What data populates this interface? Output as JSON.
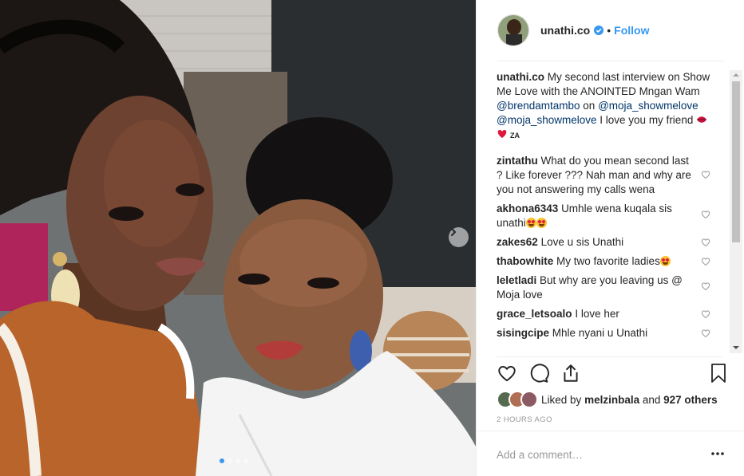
{
  "post": {
    "username": "unathi.co",
    "separator": "•",
    "follow_label": "Follow",
    "caption_parts": {
      "text1": "My second last interview on Show Me Love with the ANOINTED Mngan Wam",
      "mention1": "@brendamtambo",
      "text2": "on",
      "mention2": "@moja_showmelove",
      "mention3": "@moja_showmelove",
      "text3": "I love you my friend",
      "za": "ZA"
    }
  },
  "comments": [
    {
      "username": "zintathu",
      "text": "What do you mean second last ? Like forever ??? Nah man and why are you not answering my calls wena"
    },
    {
      "username": "akhona6343",
      "text": "Umhle wena kuqala sis unathi"
    },
    {
      "username": "zakes62",
      "text": "Love u sis Unathi"
    },
    {
      "username": "thabowhite",
      "text": "My two favorite ladies"
    },
    {
      "username": "leletladi",
      "text": "But why are you leaving us @ Moja love"
    },
    {
      "username": "grace_letsoalo",
      "text": "I love her"
    },
    {
      "username": "sisingcipe",
      "text": "Mhle nyani u Unathi"
    }
  ],
  "likes": {
    "prefix": "Liked by",
    "user": "melzinbala",
    "middle": "and",
    "count": "927 others"
  },
  "timestamp": "2 HOURS AGO",
  "add_comment_placeholder": "Add a comment…",
  "icons": {
    "like": "heart-outline-icon",
    "comment": "comment-bubble-icon",
    "share": "share-upload-icon",
    "save": "bookmark-icon",
    "more": "more-horizontal-icon",
    "verified": "verified-badge-icon",
    "next": "chevron-right-icon"
  },
  "colors": {
    "link": "#3897f0",
    "mention": "#003569",
    "muted": "#999999",
    "text": "#262626"
  }
}
